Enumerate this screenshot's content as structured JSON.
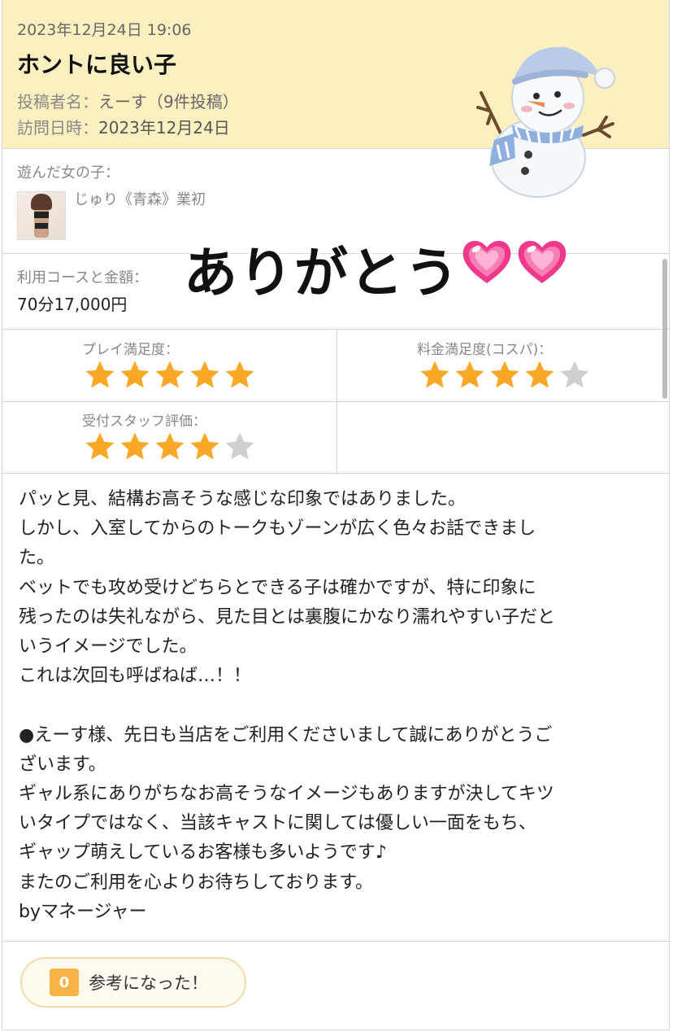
{
  "review": {
    "date": "2023年12月24日 19:06",
    "title": "ホントに良い子",
    "poster_label": "投稿者名：",
    "poster_value": "えーす（9件投稿）",
    "visit_label": "訪問日時：",
    "visit_value": "2023年12月24日"
  },
  "girl": {
    "label": "遊んだ女の子：",
    "name": "じゅり《青森》業初"
  },
  "course": {
    "label": "利用コースと金額：",
    "value": "70分17,000円"
  },
  "ratings": [
    {
      "label": "プレイ満足度：",
      "stars": 5,
      "max": 5
    },
    {
      "label": "料金満足度(コスパ)：",
      "stars": 4,
      "max": 5
    },
    {
      "label": "受付スタッフ評価：",
      "stars": 4,
      "max": 5
    }
  ],
  "body": "パッと見、結構お高そうな感じな印象ではありました。\nしかし、入室してからのトークもゾーンが広く色々お話できまし\nた。\nベットでも攻め受けどちらとできる子は確かですが、特に印象に\n残ったのは失礼ながら、見た目とは裏腹にかなり濡れやすい子だと\nいうイメージでした。\nこれは次回も呼ばねば…！！\n\n●えーす様、先日も当店をご利用くださいまして誠にありがとうご\nざいます。\nギャル系にありがちなお高そうなイメージもありますが決してキツ\nいタイプではなく、当該キャストに関しては優しい一面をもち、\nギャップ萌えしているお客様も多いようです♪\nまたのご利用を心よりお待ちしております。\nbyマネージャー",
  "helpful": {
    "count": "0",
    "label": "参考になった！"
  },
  "overlay": {
    "text": "ありがとう",
    "icons": [
      "snowman-sticker",
      "heart-icon",
      "heart-icon"
    ]
  },
  "colors": {
    "header_bg": "#fcefc0",
    "star_on": "#f9a825",
    "star_off": "#cfcfcf",
    "badge": "#f6b446",
    "heart": "#ef3a8c"
  }
}
